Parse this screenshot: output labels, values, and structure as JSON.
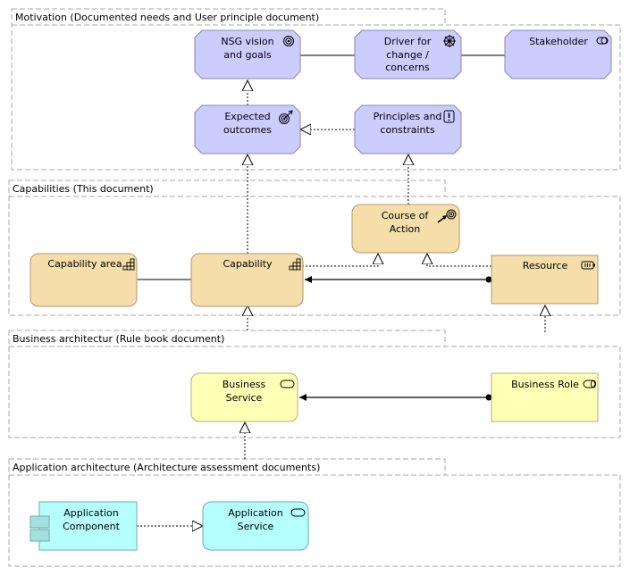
{
  "colors": {
    "motivation_fill": "#ccccff",
    "motivation_stroke": "#8888aa",
    "strategy_fill": "#f5deaa",
    "strategy_stroke": "#b09a70",
    "business_fill": "#ffffb5",
    "business_stroke": "#b0b070",
    "application_fill": "#b5ffff",
    "application_stroke": "#6aabab",
    "group_stroke": "#aaaaaa"
  },
  "groups": [
    {
      "id": "g-motivation",
      "label": "Motivation (Documented needs and User principle document)"
    },
    {
      "id": "g-capabilities",
      "label": "Capabilities (This document)"
    },
    {
      "id": "g-business",
      "label": "Business architectur (Rule book document)"
    },
    {
      "id": "g-application",
      "label": "Application architecture (Architecture assessment documents)"
    }
  ],
  "elements": [
    {
      "id": "nsg",
      "lines": [
        "NSG vision",
        "and goals"
      ],
      "type": "goal",
      "icon": "goal-icon"
    },
    {
      "id": "driver",
      "lines": [
        "Driver for",
        "change /",
        "concerns"
      ],
      "type": "driver",
      "icon": "driver-icon"
    },
    {
      "id": "stakeholder",
      "lines": [
        "Stakeholder"
      ],
      "type": "stakeholder",
      "icon": "stakeholder-icon"
    },
    {
      "id": "outcome",
      "lines": [
        "Expected",
        "outcomes"
      ],
      "type": "outcome",
      "icon": "outcome-icon"
    },
    {
      "id": "principle",
      "lines": [
        "Principles and",
        "constraints"
      ],
      "type": "principle",
      "icon": "principle-icon"
    },
    {
      "id": "course",
      "lines": [
        "Course of",
        "Action"
      ],
      "type": "course-of-action",
      "icon": "course-of-action-icon"
    },
    {
      "id": "caparea",
      "lines": [
        "Capability area"
      ],
      "type": "capability",
      "icon": "capability-icon"
    },
    {
      "id": "capability",
      "lines": [
        "Capability"
      ],
      "type": "capability",
      "icon": "capability-icon"
    },
    {
      "id": "resource",
      "lines": [
        "Resource"
      ],
      "type": "resource",
      "icon": "resource-icon"
    },
    {
      "id": "bservice",
      "lines": [
        "Business",
        "Service"
      ],
      "type": "business-service",
      "icon": "service-icon"
    },
    {
      "id": "brole",
      "lines": [
        "Business Role"
      ],
      "type": "business-role",
      "icon": "role-icon"
    },
    {
      "id": "appcomp",
      "lines": [
        "Application",
        "Component"
      ],
      "type": "application-component",
      "icon": "component-icon"
    },
    {
      "id": "appservice",
      "lines": [
        "Application",
        "Service"
      ],
      "type": "application-service",
      "icon": "service-icon"
    }
  ],
  "relations": [
    {
      "from": "nsg",
      "to": "driver",
      "type": "association"
    },
    {
      "from": "driver",
      "to": "stakeholder",
      "type": "association"
    },
    {
      "from": "outcome",
      "to": "nsg",
      "type": "realization"
    },
    {
      "from": "principle",
      "to": "outcome",
      "type": "realization"
    },
    {
      "from": "capability",
      "to": "outcome",
      "type": "realization"
    },
    {
      "from": "course",
      "to": "principle",
      "type": "realization"
    },
    {
      "from": "caparea",
      "to": "capability",
      "type": "composition"
    },
    {
      "from": "capability",
      "to": "course",
      "type": "realization"
    },
    {
      "from": "resource",
      "to": "course",
      "type": "realization"
    },
    {
      "from": "resource",
      "to": "capability",
      "type": "assignment"
    },
    {
      "from": "bservice",
      "to": "capability",
      "type": "realization"
    },
    {
      "from": "brole",
      "to": "bservice",
      "type": "assignment"
    },
    {
      "from": "brole",
      "to": "resource",
      "type": "realization"
    },
    {
      "from": "appservice",
      "to": "bservice",
      "type": "realization"
    },
    {
      "from": "appcomp",
      "to": "appservice",
      "type": "realization"
    }
  ]
}
